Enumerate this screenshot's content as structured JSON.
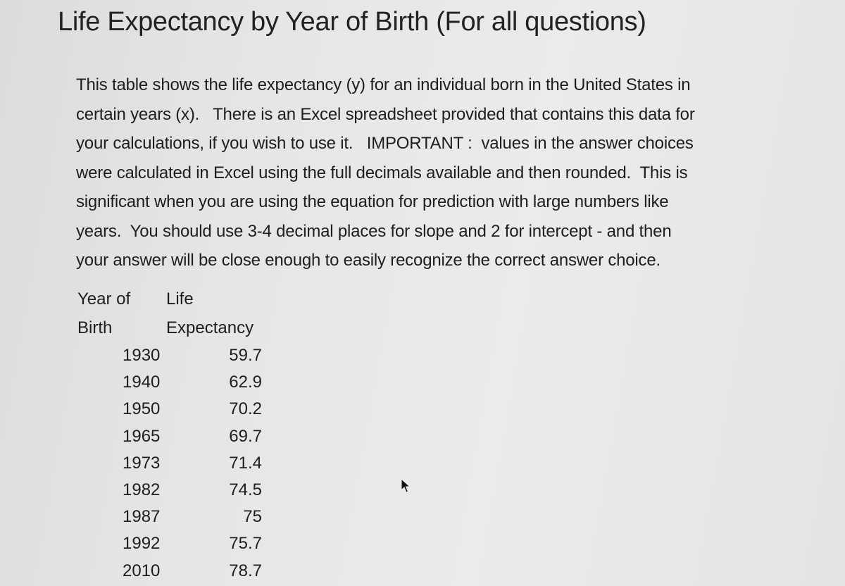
{
  "title": "Life Expectancy by Year of Birth (For all questions)",
  "intro_lines": [
    "This table shows the life expectancy (y) for an individual born in the United States in",
    "certain years (x).   There is an Excel spreadsheet provided that contains this data for",
    "your calculations, if you wish to use it.   IMPORTANT :  values in the answer choices",
    "were calculated in Excel using the full decimals available and then rounded.  This is",
    "significant when you are using the equation for prediction with large numbers like",
    "years.  You should use 3-4 decimal places for slope and 2 for intercept - and then",
    "your answer will be close enough to easily recognize the correct answer choice."
  ],
  "table": {
    "headers": [
      {
        "line1": "Year of",
        "line2": "Birth"
      },
      {
        "line1": "Life",
        "line2": "Expectancy"
      }
    ],
    "rows": [
      {
        "year": "1930",
        "life": "59.7"
      },
      {
        "year": "1940",
        "life": "62.9"
      },
      {
        "year": "1950",
        "life": "70.2"
      },
      {
        "year": "1965",
        "life": "69.7"
      },
      {
        "year": "1973",
        "life": "71.4"
      },
      {
        "year": "1982",
        "life": "74.5"
      },
      {
        "year": "1987",
        "life": "75"
      },
      {
        "year": "1992",
        "life": "75.7"
      },
      {
        "year": "2010",
        "life": "78.7"
      }
    ]
  },
  "icons": {
    "cursor": "mouse-pointer-arrow"
  }
}
